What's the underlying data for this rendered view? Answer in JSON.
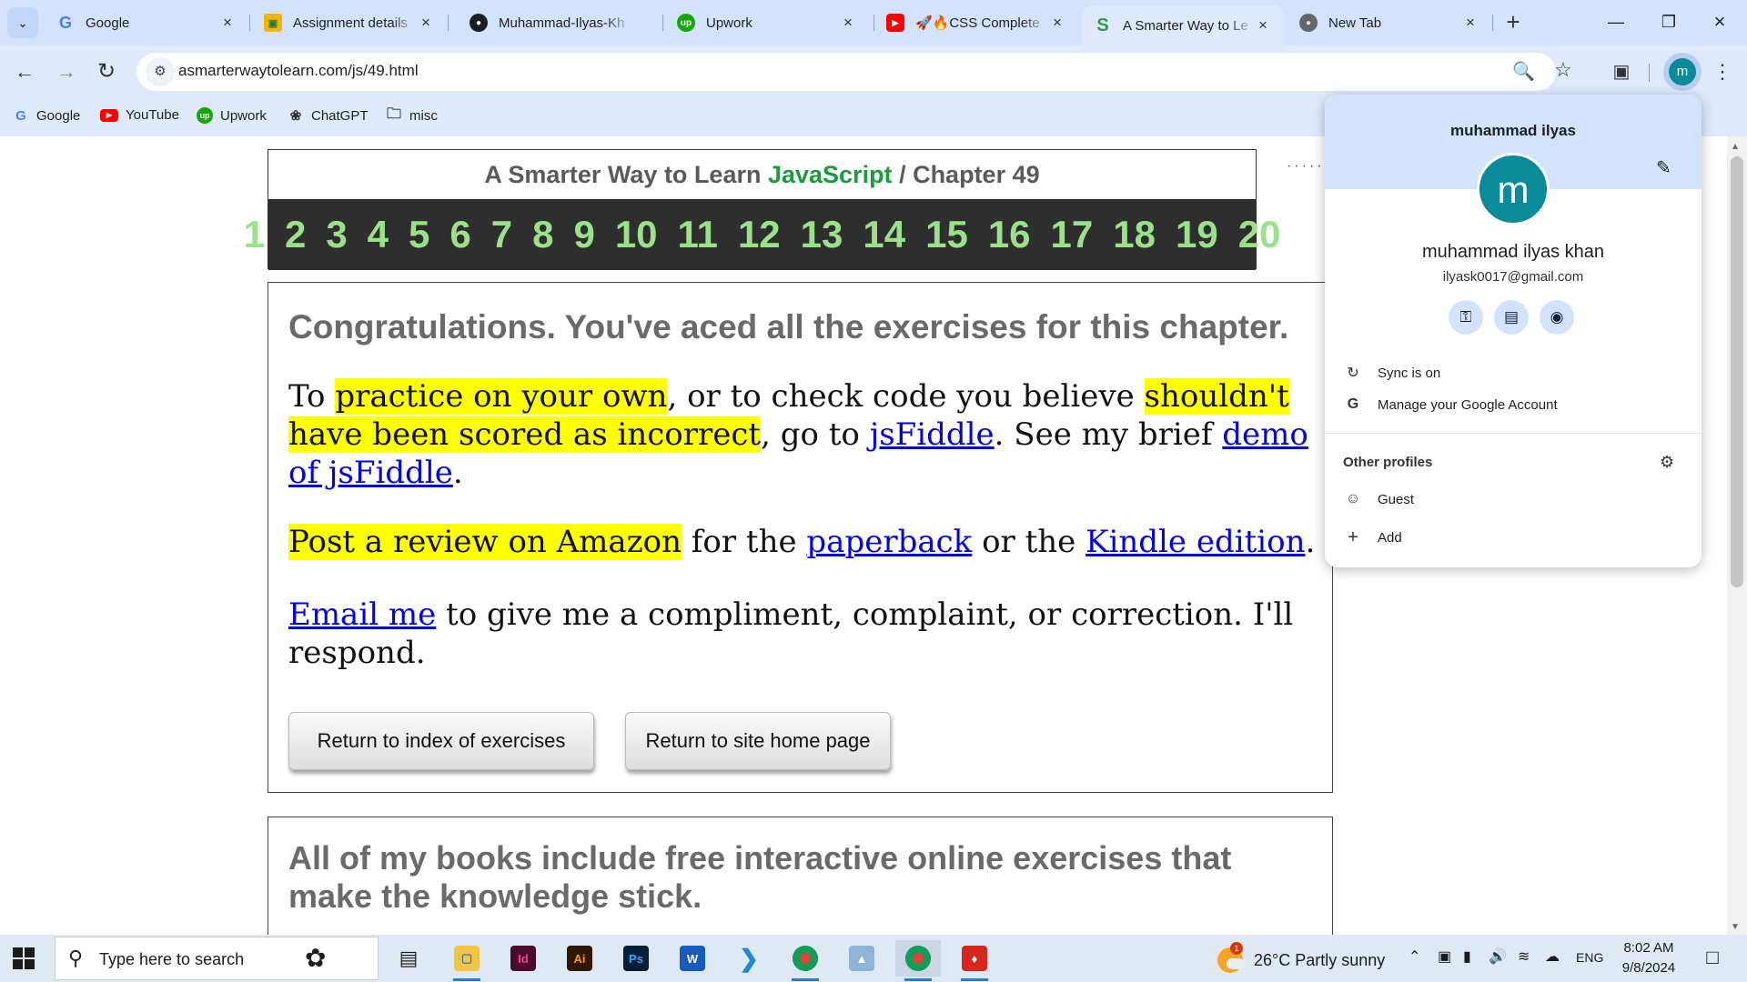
{
  "browser": {
    "tabs": [
      {
        "title": "Google",
        "icon": "google-icon",
        "active": false
      },
      {
        "title": "Assignment details",
        "icon": "classroom-icon",
        "active": false
      },
      {
        "title": "Muhammad-Ilyas-Kh",
        "icon": "github-icon",
        "active": false
      },
      {
        "title": "Upwork",
        "icon": "upwork-icon",
        "active": false
      },
      {
        "title": "🚀🔥CSS Complete",
        "icon": "youtube-icon",
        "active": false
      },
      {
        "title": "A Smarter Way to Le",
        "icon": "smarter-way-icon",
        "active": true
      },
      {
        "title": "New Tab",
        "icon": "chrome-icon",
        "active": false
      }
    ],
    "url": "asmarterwaytolearn.com/js/49.html",
    "profile_initial": "m",
    "bookmarks": [
      {
        "label": "Google",
        "icon": "google-icon"
      },
      {
        "label": "YouTube",
        "icon": "youtube-icon"
      },
      {
        "label": "Upwork",
        "icon": "upwork-icon"
      },
      {
        "label": "ChatGPT",
        "icon": "chatgpt-icon"
      },
      {
        "label": "misc",
        "icon": "folder-icon"
      }
    ]
  },
  "page": {
    "header": {
      "title_prefix": "A Smarter Way to Learn ",
      "title_js": "JavaScript",
      "title_suffix": " / Chapter 49",
      "chapters": [
        "1",
        "2",
        "3",
        "4",
        "5",
        "6",
        "7",
        "8",
        "9",
        "10",
        "11",
        "12",
        "13",
        "14",
        "15",
        "16",
        "17",
        "18",
        "19",
        "20"
      ]
    },
    "congrats": {
      "heading": "Congratulations. You've aced all the exercises for this chapter.",
      "p1": {
        "t1": "To ",
        "hl1": "practice on your own",
        "t2": ", or to check code you believe ",
        "hl2": "shouldn't have been scored as incorrect",
        "t3": ", go to ",
        "link1": "jsFiddle",
        "t4": ". See my brief ",
        "link2": "demo of jsFiddle",
        "t5": "."
      },
      "p2": {
        "hl": "Post a review on Amazon",
        "t1": " for the ",
        "link1": "paperback",
        "t2": " or the ",
        "link2": "Kindle edition",
        "t3": "."
      },
      "p3": {
        "link": "Email me",
        "t1": " to give me a compliment, complaint, or correction. I'll respond."
      },
      "buttons": {
        "index": "Return to index of exercises",
        "home": "Return to site home page"
      }
    },
    "books": {
      "text": " All of my books include free interactive online exercises that make the knowledge stick."
    }
  },
  "profile_popup": {
    "name_top": "muhammad ilyas",
    "avatar_initial": "m",
    "full_name": "muhammad ilyas khan",
    "email": "ilyask0017@gmail.com",
    "sync": "Sync is on",
    "manage": "Manage your Google Account",
    "other_profiles": "Other profiles",
    "guest": "Guest",
    "add": "Add"
  },
  "taskbar": {
    "search_placeholder": "Type here to search",
    "weather": "26°C  Partly sunny",
    "language": "ENG",
    "time": "8:02 AM",
    "date": "9/8/2024",
    "weather_badge": "1"
  }
}
